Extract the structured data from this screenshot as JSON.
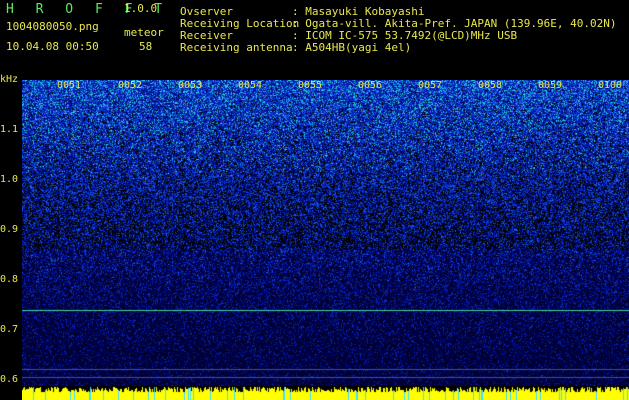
{
  "app": {
    "name": "H R O F F T",
    "version": "1.0.0"
  },
  "file": {
    "name": "1004080050.png",
    "datetime": "10.04.08 00:50"
  },
  "meteor": {
    "label": "meteor",
    "count": "58"
  },
  "info": [
    {
      "key": "Ovserver",
      "value": ": Masayuki Kobayashi"
    },
    {
      "key": "Receiving Location",
      "value": ": Ogata-vill. Akita-Pref. JAPAN (139.96E, 40.02N)"
    },
    {
      "key": "Receiver",
      "value": ": ICOM IC-575 53.7492(@LCD)MHz USB"
    },
    {
      "key": "Receiving antenna",
      "value": ": A504HB(yagi 4el)"
    }
  ],
  "axis": {
    "y_unit": "kHz",
    "y_ticks": [
      "1.1",
      "1.0",
      "0.9",
      "0.8",
      "0.7",
      "0.6"
    ],
    "x_ticks": [
      "0051",
      "0052",
      "0053",
      "0054",
      "0055",
      "0056",
      "0057",
      "0058",
      "0059",
      "0100"
    ]
  },
  "colors": {
    "background": "#000000",
    "text": "#e8e850",
    "logo": "#5fe85f",
    "carrier_line": "#40d0a0",
    "amplitude_bar": "#ffff00"
  }
}
